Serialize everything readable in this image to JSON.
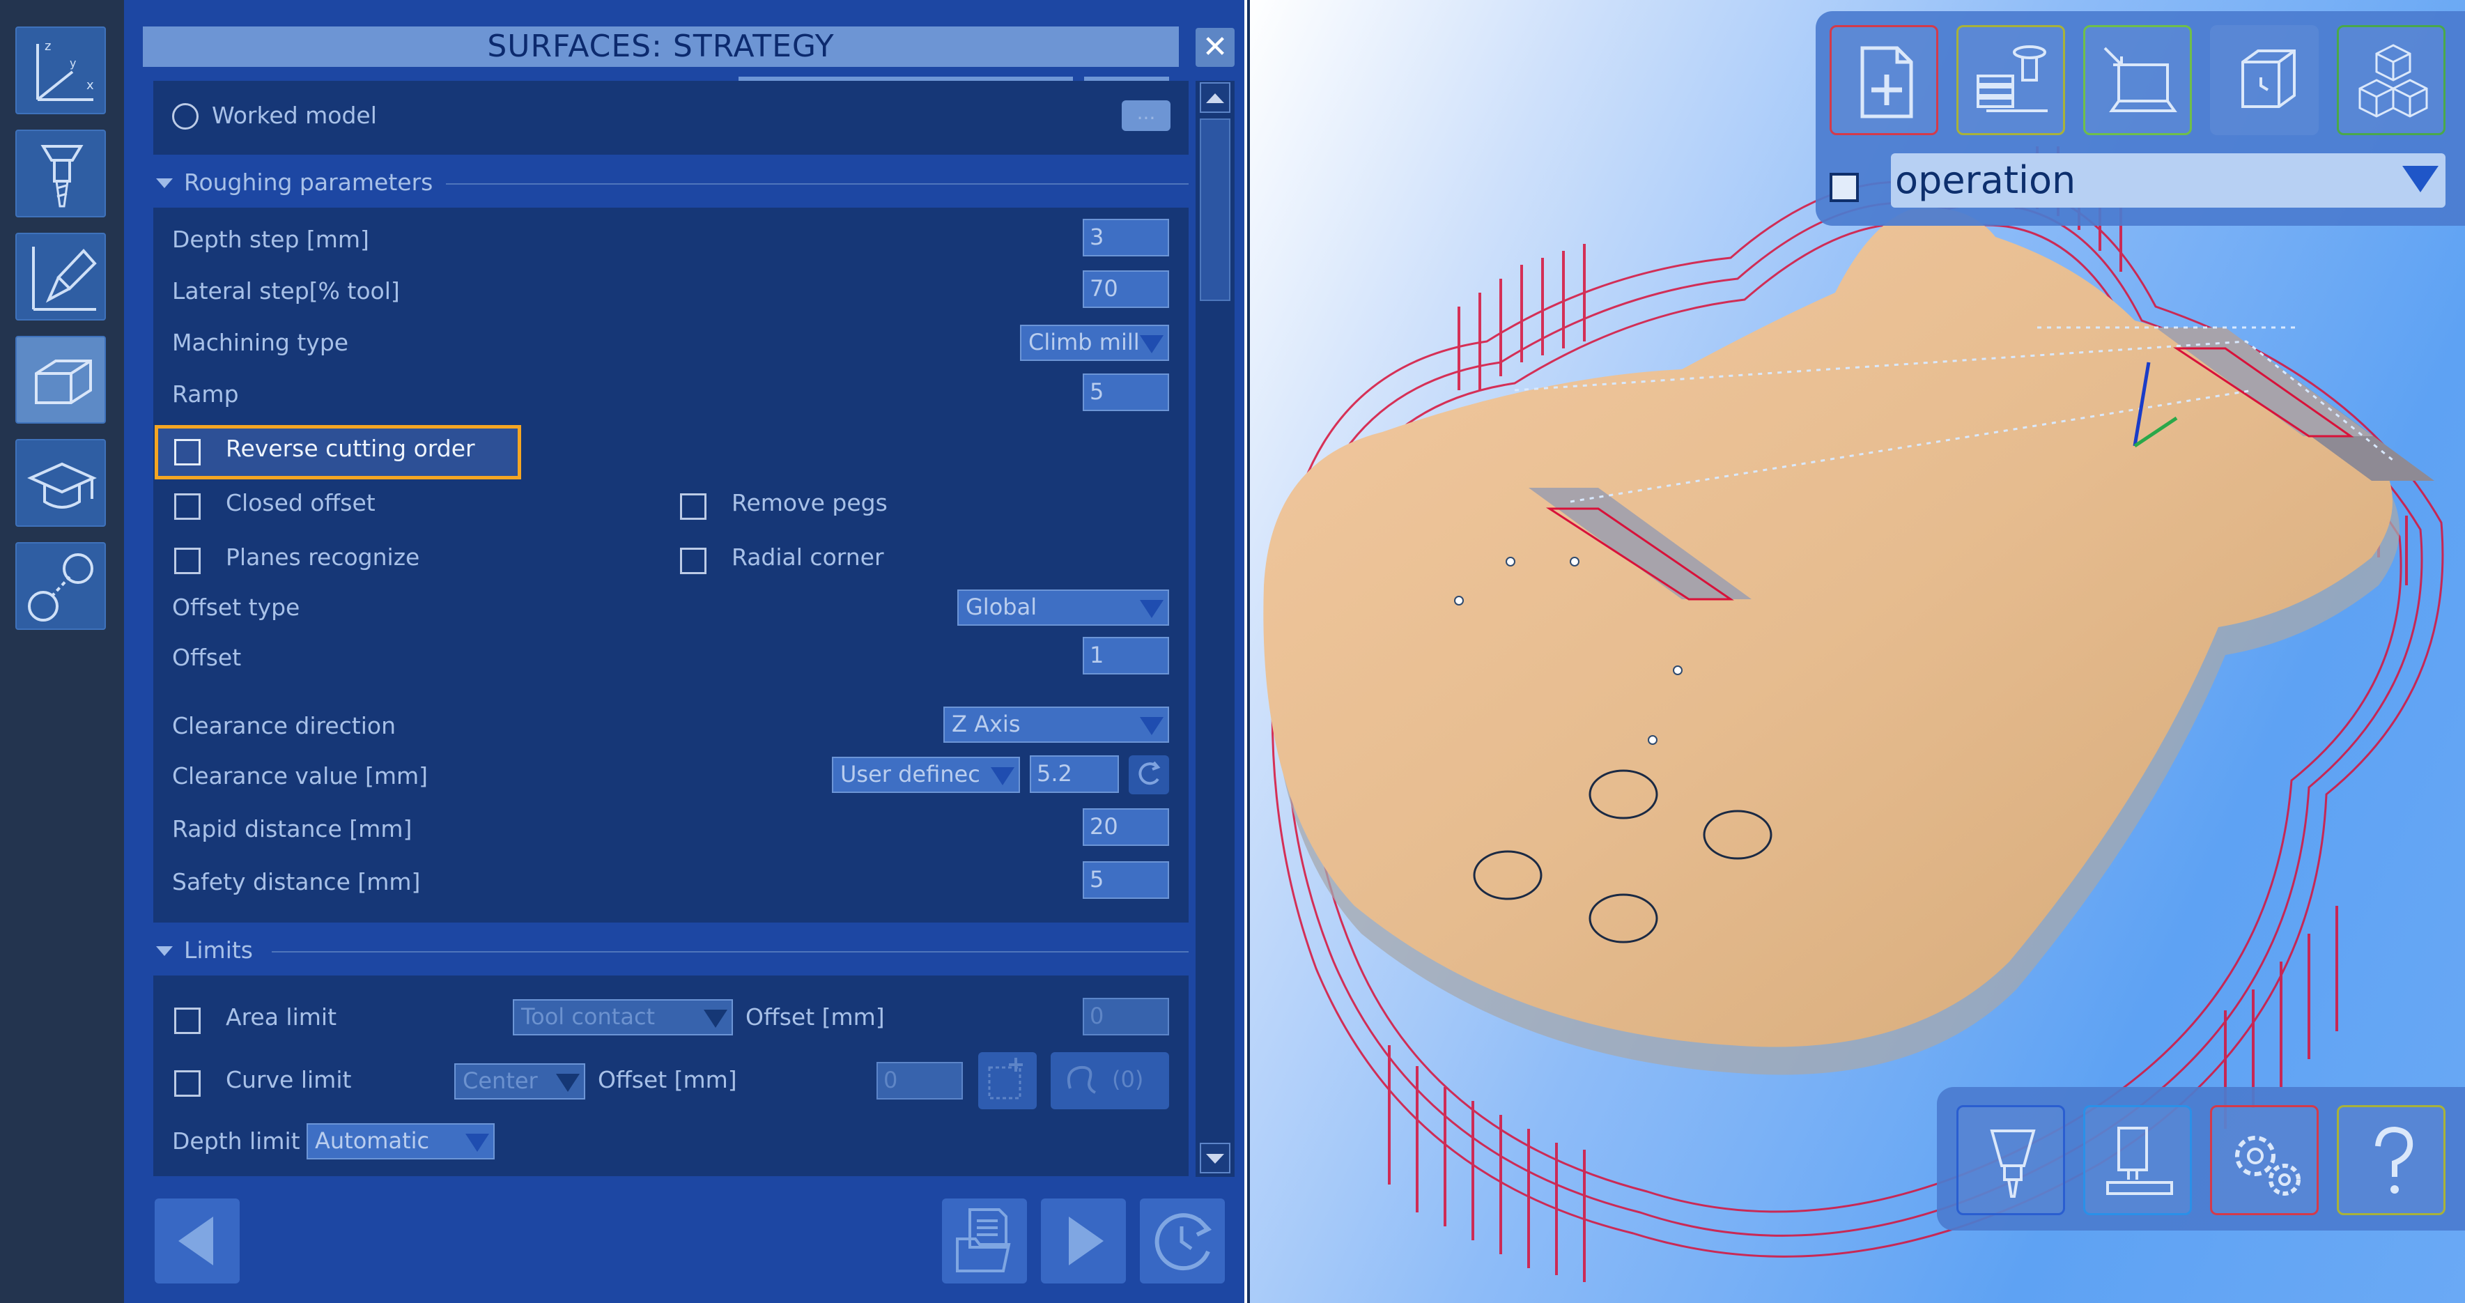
{
  "panel": {
    "title": "SURFACES:  STRATEGY",
    "close_glyph": "✕",
    "worked_model_label": "Worked model",
    "browse_label": "..."
  },
  "roughing": {
    "section_title": "Roughing parameters",
    "depth_step_label": "Depth step [mm]",
    "depth_step_value": "3",
    "lateral_step_label": "Lateral step[% tool]",
    "lateral_step_value": "70",
    "machining_type_label": "Machining type",
    "machining_type_value": "Climb mill",
    "ramp_label": "Ramp",
    "ramp_value": "5",
    "reverse_label": "Reverse cutting order",
    "closed_offset_label": "Closed offset",
    "remove_pegs_label": "Remove pegs",
    "planes_recognize_label": "Planes recognize",
    "radial_corner_label": "Radial corner",
    "offset_type_label": "Offset type",
    "offset_type_value": "Global",
    "offset_label": "Offset",
    "offset_value": "1",
    "clearance_dir_label": "Clearance direction",
    "clearance_dir_value": "Z Axis",
    "clearance_value_label": "Clearance value [mm]",
    "clearance_mode_value": "User definec",
    "clearance_value": "5.2",
    "rapid_label": "Rapid distance [mm]",
    "rapid_value": "20",
    "safety_label": "Safety distance [mm]",
    "safety_value": "5"
  },
  "limits": {
    "section_title": "Limits",
    "area_limit_label": "Area limit",
    "area_limit_mode": "Tool contact",
    "area_offset_label": "Offset [mm]",
    "area_offset_value": "0",
    "curve_limit_label": "Curve limit",
    "curve_limit_mode": "Center",
    "curve_offset_label": "Offset [mm]",
    "curve_offset_value": "0",
    "curve_count": "(0)",
    "depth_limit_label": "Depth limit",
    "depth_limit_value": "Automatic"
  },
  "viewport": {
    "operation_dropdown": "operation"
  },
  "colors": {
    "panel_bg": "#1d47a3",
    "highlight": "#f5a623",
    "toolpath": "#d8123a"
  },
  "icons": {
    "left_toolbar": [
      "axes-icon",
      "tool-icon",
      "tool-axis-icon",
      "stock-box-icon",
      "graduation-cap-icon",
      "link-points-icon"
    ],
    "top_toolbar": [
      "new-document-icon",
      "machine-stack-icon",
      "export-computer-icon",
      "box-clock-icon",
      "cubes-icon"
    ],
    "bottom_toolbar": [
      "tool-holder-icon",
      "machine-icon",
      "gears-icon",
      "help-icon"
    ]
  }
}
